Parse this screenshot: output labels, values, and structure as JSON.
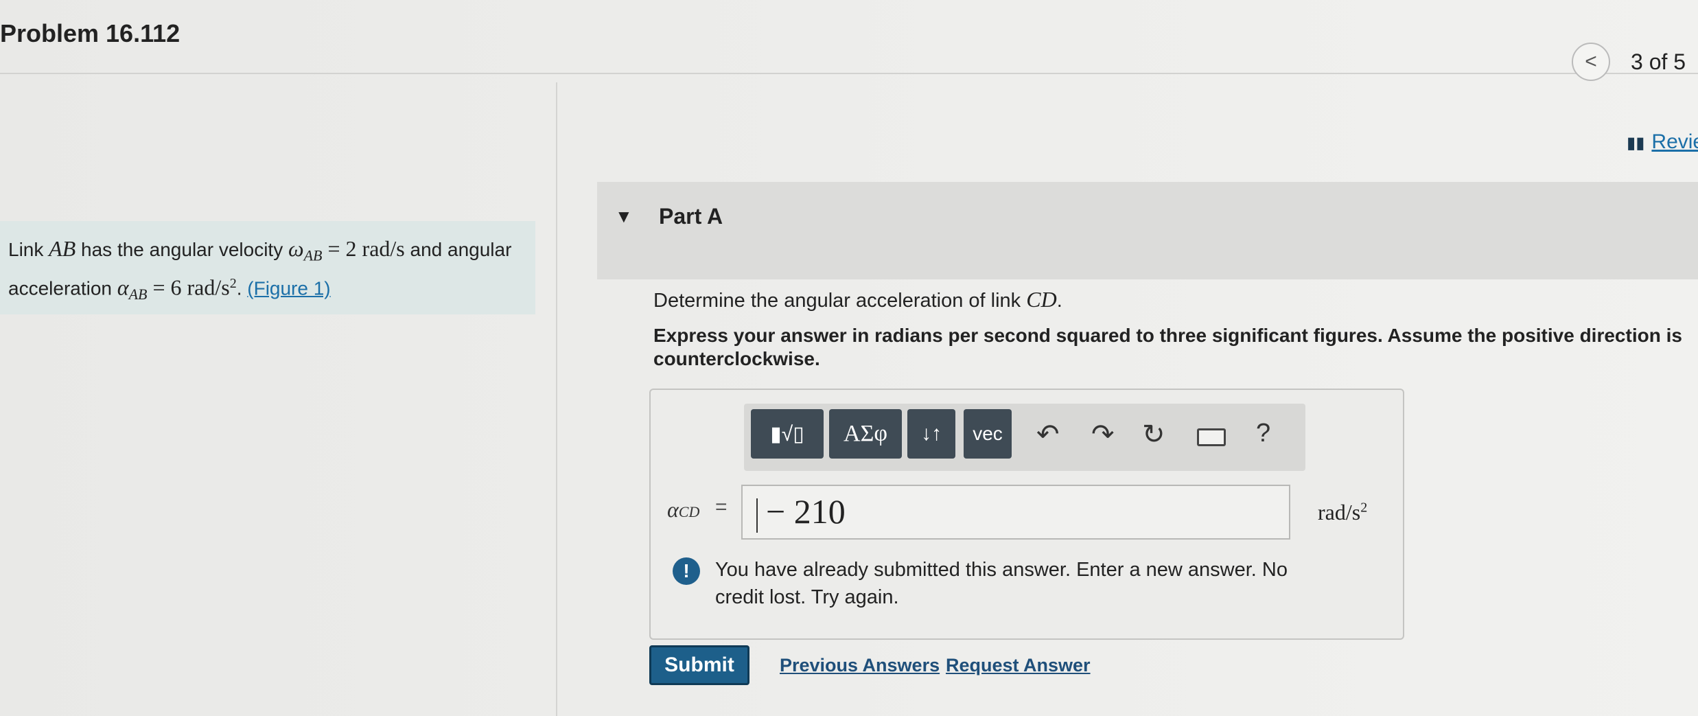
{
  "header": {
    "problem_title": "Problem 16.112",
    "nav_prev_symbol": "<",
    "nav_count": "3 of 5",
    "review_label": "Revie"
  },
  "problem": {
    "text_1": "Link ",
    "var_ab": "AB",
    "text_2": " has the angular velocity ",
    "omega": "ω",
    "omega_sub": "AB",
    "omega_value": " = 2 rad/s",
    "text_3": " and angular acceleration ",
    "alpha": "α",
    "alpha_sub": "AB",
    "alpha_value": " = 6 rad/s",
    "alpha_exp": "2",
    "text_4": ". ",
    "figure_link": "(Figure 1)"
  },
  "part": {
    "caret": "▼",
    "title": "Part A",
    "question_text": "Determine the angular acceleration of link ",
    "question_var": "CD",
    "question_end": ".",
    "instruction": "Express your answer in radians per second squared to three significant figures. Assume the positive direction is counterclockwise."
  },
  "toolbar": {
    "templates_label": "▮√▯",
    "greek_label": "ΑΣφ",
    "arrows_label": "↓↑",
    "vec_label": "vec",
    "undo_symbol": "↶",
    "redo_symbol": "↷",
    "reset_symbol": "↻",
    "help_symbol": "?"
  },
  "answer": {
    "var": "α",
    "var_sub": "CD",
    "equals": "=",
    "value": "− 210",
    "unit": "rad/s",
    "unit_exp": "2"
  },
  "feedback": {
    "icon": "!",
    "message": "You have already submitted this answer. Enter a new answer. No credit lost. Try again."
  },
  "actions": {
    "submit": "Submit",
    "previous_answers": "Previous Answers",
    "request_answer": "Request Answer"
  }
}
